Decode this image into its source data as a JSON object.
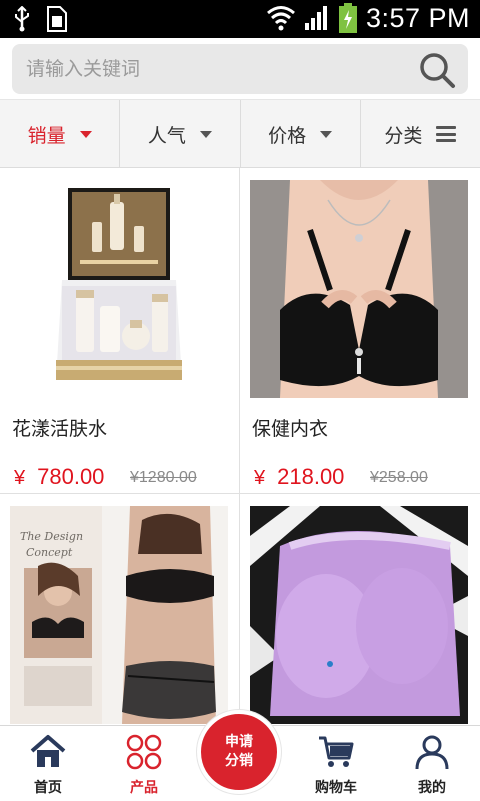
{
  "status_bar": {
    "time": "3:57 PM",
    "icons": [
      "usb-icon",
      "sim-icon",
      "wifi-icon",
      "signal-icon",
      "battery-charging-icon"
    ]
  },
  "search": {
    "placeholder": "请输入关键词"
  },
  "sort_tabs": [
    {
      "label": "销量",
      "active": true
    },
    {
      "label": "人气",
      "active": false
    },
    {
      "label": "价格",
      "active": false
    },
    {
      "label": "分类",
      "active": false
    }
  ],
  "products": [
    {
      "name": "花漾活肤水",
      "currency": "¥",
      "price": "780.00",
      "old_price": "¥1280.00"
    },
    {
      "name": "保健内衣",
      "currency": "¥",
      "price": "218.00",
      "old_price": "¥258.00"
    },
    {
      "name": "",
      "currency": "",
      "price": "",
      "old_price": ""
    },
    {
      "name": "",
      "currency": "",
      "price": "",
      "old_price": ""
    }
  ],
  "bottom_nav": {
    "items": [
      {
        "label": "首页",
        "icon": "home-icon"
      },
      {
        "label": "产品",
        "icon": "grid-icon",
        "active": true
      },
      {
        "label": "购物车",
        "icon": "cart-icon"
      },
      {
        "label": "我的",
        "icon": "user-icon"
      }
    ],
    "center_button": {
      "line1": "申请",
      "line2": "分销"
    }
  },
  "colors": {
    "accent": "#d9232d",
    "price": "#e0141e"
  },
  "image_text": {
    "lingerie_brochure": "The Design Concept"
  }
}
